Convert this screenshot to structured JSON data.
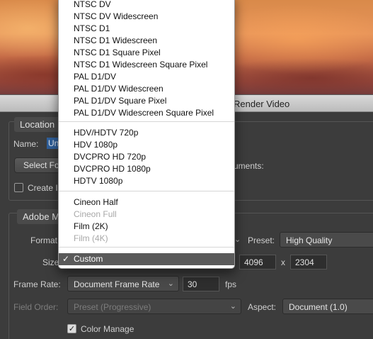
{
  "dialog": {
    "title": "Render Video",
    "location": {
      "legend": "Location",
      "name_label": "Name:",
      "name_value": "Un",
      "select_folder_label": "Select Fo",
      "documents_text": "uments:",
      "create_label": "Create I"
    },
    "adobe": {
      "legend": "Adobe M",
      "format_label": "Format",
      "preset_label": "Preset:",
      "preset_value": "High Quality",
      "size_label": "Size",
      "width_value": "4096",
      "x_label": "x",
      "height_value": "2304",
      "frame_rate_label": "Frame Rate:",
      "frame_rate_value": "Document Frame Rate",
      "fps_value": "30",
      "fps_label": "fps",
      "field_order_label": "Field Order:",
      "field_order_value": "Preset (Progressive)",
      "aspect_label": "Aspect:",
      "aspect_value": "Document (1.0)",
      "color_manage_label": "Color Manage",
      "color_manage_checked": true
    }
  },
  "menu": {
    "items": [
      {
        "label": "NTSC DV",
        "enabled": true
      },
      {
        "label": "NTSC DV Widescreen",
        "enabled": true
      },
      {
        "label": "NTSC D1",
        "enabled": true
      },
      {
        "label": "NTSC D1 Widescreen",
        "enabled": true
      },
      {
        "label": "NTSC D1 Square Pixel",
        "enabled": true
      },
      {
        "label": "NTSC D1 Widescreen Square Pixel",
        "enabled": true
      },
      {
        "label": "PAL D1/DV",
        "enabled": true
      },
      {
        "label": "PAL D1/DV Widescreen",
        "enabled": true
      },
      {
        "label": "PAL D1/DV Square Pixel",
        "enabled": true
      },
      {
        "label": "PAL D1/DV Widescreen Square Pixel",
        "enabled": true
      },
      {
        "label": "HDV/HDTV 720p",
        "enabled": true
      },
      {
        "label": "HDV 1080p",
        "enabled": true
      },
      {
        "label": "DVCPRO HD 720p",
        "enabled": true
      },
      {
        "label": "DVCPRO HD 1080p",
        "enabled": true
      },
      {
        "label": "HDTV 1080p",
        "enabled": true
      },
      {
        "label": "Cineon Half",
        "enabled": true
      },
      {
        "label": "Cineon Full",
        "enabled": false
      },
      {
        "label": "Film (2K)",
        "enabled": true
      },
      {
        "label": "Film (4K)",
        "enabled": false
      },
      {
        "label": "Custom",
        "enabled": true,
        "selected": true
      }
    ],
    "checkmark": "✓"
  }
}
